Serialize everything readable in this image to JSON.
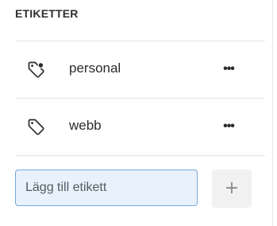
{
  "panel": {
    "heading": "ETIKETTER"
  },
  "tags": [
    {
      "label": "personal",
      "icon": "tag-active-icon",
      "more_label": "•••"
    },
    {
      "label": "webb",
      "icon": "tag-icon",
      "more_label": "•••"
    }
  ],
  "add_tag": {
    "placeholder": "Lägg till etikett",
    "value": "",
    "button_label": "+"
  },
  "colors": {
    "input_background": "#e8f1fc",
    "input_border": "#7aa7d8",
    "add_button_background": "#f1f1f1"
  }
}
